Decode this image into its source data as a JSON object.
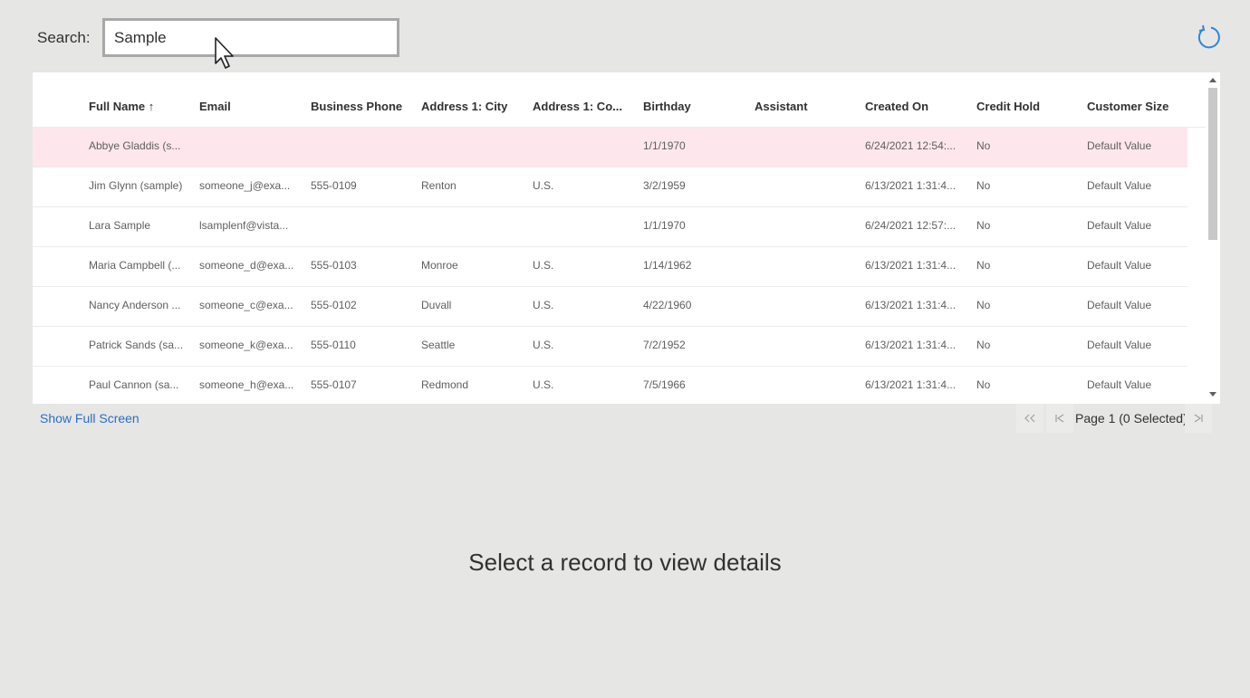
{
  "search": {
    "label": "Search:",
    "value": "Sample"
  },
  "grid": {
    "columns": [
      "Full Name ↑",
      "Email",
      "Business Phone",
      "Address 1: City",
      "Address 1: Co...",
      "Birthday",
      "Assistant",
      "Created On",
      "Credit Hold",
      "Customer Size"
    ],
    "rows": [
      [
        "Abbye Gladdis (s...",
        "",
        "",
        "",
        "",
        "1/1/1970",
        "",
        "6/24/2021 12:54:...",
        "No",
        "Default Value"
      ],
      [
        "Jim Glynn (sample)",
        "someone_j@exa...",
        "555-0109",
        "Renton",
        "U.S.",
        "3/2/1959",
        "",
        "6/13/2021 1:31:4...",
        "No",
        "Default Value"
      ],
      [
        "Lara Sample",
        "lsamplenf@vista...",
        "",
        "",
        "",
        "1/1/1970",
        "",
        "6/24/2021 12:57:...",
        "No",
        "Default Value"
      ],
      [
        "Maria Campbell (...",
        "someone_d@exa...",
        "555-0103",
        "Monroe",
        "U.S.",
        "1/14/1962",
        "",
        "6/13/2021 1:31:4...",
        "No",
        "Default Value"
      ],
      [
        "Nancy Anderson ...",
        "someone_c@exa...",
        "555-0102",
        "Duvall",
        "U.S.",
        "4/22/1960",
        "",
        "6/13/2021 1:31:4...",
        "No",
        "Default Value"
      ],
      [
        "Patrick Sands (sa...",
        "someone_k@exa...",
        "555-0110",
        "Seattle",
        "U.S.",
        "7/2/1952",
        "",
        "6/13/2021 1:31:4...",
        "No",
        "Default Value"
      ],
      [
        "Paul Cannon (sa...",
        "someone_h@exa...",
        "555-0107",
        "Redmond",
        "U.S.",
        "7/5/1966",
        "",
        "6/13/2021 1:31:4...",
        "No",
        "Default Value"
      ]
    ]
  },
  "footer": {
    "fullscreen_label": "Show Full Screen",
    "page_label": "Page 1 (0 Selected)"
  },
  "detail": {
    "empty_message": "Select a record to view details"
  },
  "colors": {
    "highlight_row": "#fde7ec",
    "link": "#2b6fc2",
    "accent": "#2b88d8"
  }
}
